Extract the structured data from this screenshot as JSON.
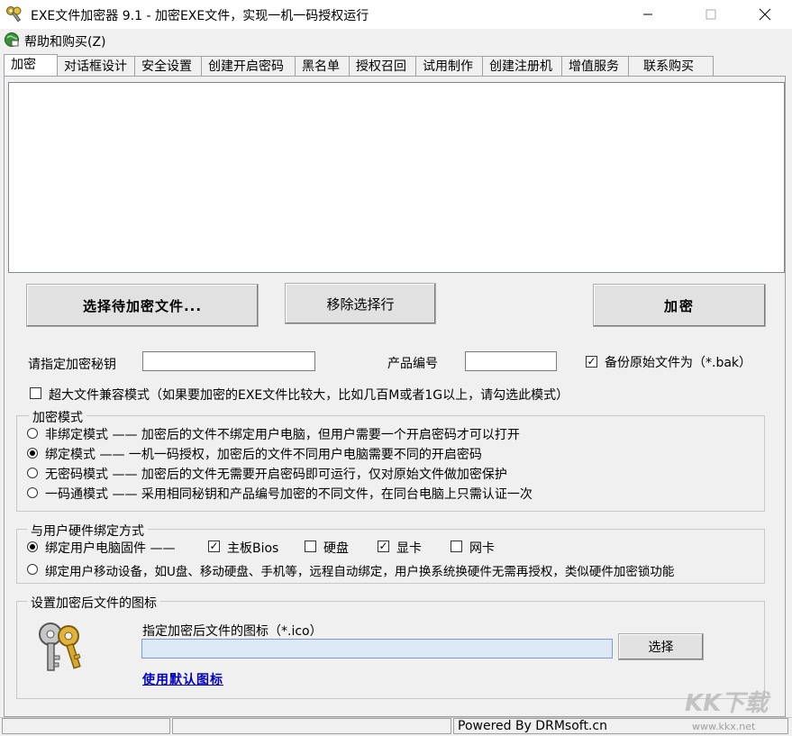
{
  "window": {
    "title": "EXE文件加密器 9.1 - 加密EXE文件，实现一机一码授权运行",
    "min_icon": "minimize-icon",
    "max_icon": "maximize-icon",
    "close_icon": "close-icon"
  },
  "menu": {
    "help": "帮助和购买(Z)"
  },
  "tabs": [
    {
      "label": "加密",
      "active": true
    },
    {
      "label": "对话框设计"
    },
    {
      "label": "安全设置"
    },
    {
      "label": "创建开启密码"
    },
    {
      "label": "黑名单"
    },
    {
      "label": "授权召回"
    },
    {
      "label": "试用制作"
    },
    {
      "label": "创建注册机"
    },
    {
      "label": "增值服务"
    },
    {
      "label": "联系购买"
    }
  ],
  "actions": {
    "select_file": "选择待加密文件...",
    "remove": "移除选择行",
    "encrypt": "加密"
  },
  "form": {
    "key_label": "请指定加密秘钥",
    "key_value": "",
    "product_label": "产品编号",
    "product_value": "",
    "backup_label": "备份原始文件为（*.bak）",
    "backup_checked": true,
    "large_mode_label": "超大文件兼容模式（如果要加密的EXE文件比较大，比如几百M或者1G以上，请勾选此模式）",
    "large_mode_checked": false
  },
  "encrypt_mode": {
    "title": "加密模式",
    "options": [
      {
        "label": "非绑定模式 —— 加密后的文件不绑定用户电脑，但用户需要一个开启密码才可以打开",
        "selected": false
      },
      {
        "label": "绑定模式 —— 一机一码授权，加密后的文件不同用户电脑需要不同的开启密码",
        "selected": true
      },
      {
        "label": "无密码模式 —— 加密后的文件无需要开启密码即可运行，仅对原始文件做加密保护",
        "selected": false
      },
      {
        "label": "一码通模式 —— 采用相同秘钥和产品编号加密的不同文件，在同台电脑上只需认证一次",
        "selected": false
      }
    ]
  },
  "binding": {
    "title": "与用户硬件绑定方式",
    "pc_label": "绑定用户电脑固件 ——",
    "pc_selected": true,
    "hw": [
      {
        "label": "主板Bios",
        "checked": true
      },
      {
        "label": "硬盘",
        "checked": false
      },
      {
        "label": "显卡",
        "checked": true
      },
      {
        "label": "网卡",
        "checked": false
      }
    ],
    "mobile_label": "绑定用户移动设备，如U盘、移动硬盘、手机等，远程自动绑定，用户换系统换硬件无需再授权，类似硬件加密锁功能",
    "mobile_selected": false
  },
  "icon_section": {
    "title": "设置加密后文件的图标",
    "hint": "指定加密后文件的图标（*.ico）",
    "path_value": "",
    "choose": "选择",
    "default_link": "使用默认图标",
    "image_icon": "keys-icon"
  },
  "status": {
    "powered": "Powered By DRMsoft.cn"
  },
  "watermark": {
    "brand": "KK下载",
    "url": "www.kkx.net"
  }
}
